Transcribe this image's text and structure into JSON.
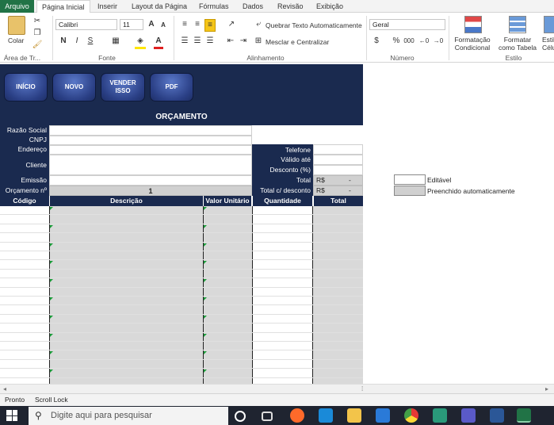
{
  "ribbon_tabs": [
    "Arquivo",
    "Página Inicial",
    "Inserir",
    "Layout da Página",
    "Fórmulas",
    "Dados",
    "Revisão",
    "Exibição"
  ],
  "clipboard": {
    "paste_label": "Colar",
    "group_label": "Área de Tr..."
  },
  "font": {
    "name": "Calibri",
    "size": "11",
    "group_label": "Fonte",
    "bold": "N",
    "italic": "I",
    "underline": "S"
  },
  "alignment": {
    "wrap_label": "Quebrar Texto Automaticamente",
    "merge_label": "Mesclar e Centralizar",
    "group_label": "Alinhamento"
  },
  "number": {
    "format": "Geral",
    "group_label": "Número",
    "percent": "%",
    "thousands": "000"
  },
  "styles": {
    "conditional_label": "Formatação Condicional",
    "table_label": "Formatar como Tabela",
    "cell_styles_label": "Estilos de Célula",
    "cell_styles_short": "Estil Célu",
    "group_label": "Estilo"
  },
  "nav_buttons": [
    "INÍCIO",
    "NOVO",
    "VENDER ISSO",
    "PDF"
  ],
  "sheet_title": "ORÇAMENTO",
  "fields_left": [
    "Razão Social",
    "CNPJ",
    "Endereço",
    "Cliente",
    "Emissão",
    "Orçamento nº"
  ],
  "quote_number": "1",
  "fields_right": [
    "Telefone",
    "Válido até",
    "Desconto (%)",
    "Total",
    "Total c/ desconto"
  ],
  "totals": {
    "currency": "R$",
    "total_value": "-",
    "discount_value": "-"
  },
  "columns": [
    "Código",
    "Descrição",
    "Valor Unitário",
    "Quantidade",
    "Total"
  ],
  "legend": {
    "editable": "Editável",
    "auto_filled": "Preenchido automaticamente"
  },
  "status": {
    "ready": "Pronto",
    "scroll_lock": "Scroll Lock"
  },
  "taskbar": {
    "search_placeholder": "Digite aqui para pesquisar"
  }
}
